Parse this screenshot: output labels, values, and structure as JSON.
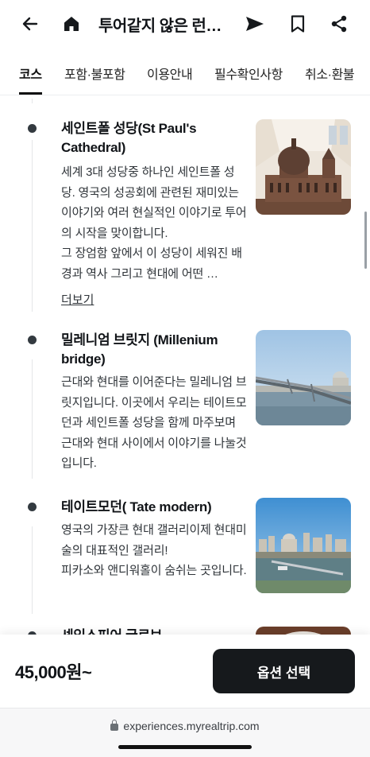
{
  "header": {
    "title": "투어같지 않은 런…",
    "icons": [
      "back-arrow-icon",
      "home-icon",
      "share-send-icon",
      "bookmark-icon",
      "share-icon"
    ]
  },
  "tabs": [
    {
      "label": "코스",
      "active": true
    },
    {
      "label": "포함·불포함",
      "active": false
    },
    {
      "label": "이용안내",
      "active": false
    },
    {
      "label": "필수확인사항",
      "active": false
    },
    {
      "label": "취소·환불",
      "active": false
    }
  ],
  "spots": [
    {
      "title": "세인트폴 성당(St Paul's Cathedral)",
      "description": "세계 3대 성당중 하나인 세인트폴 성당. 영국의 성공회에 관련된 재미있는 이야기와 여러 현실적인 이야기로 투어의 시작을 맞이합니다.\n그 장엄함 앞에서 이 성당이 세워진 배경과 역사 그리고 현대에 어떤 …",
      "more_label": "더보기",
      "image": "cathedral-photo"
    },
    {
      "title": "밀레니엄 브릿지 (Millenium bridge)",
      "description": "근대와 현대를 이어준다는 밀레니엄 브릿지입니다. 이곳에서 우리는 테이트모던과 세인트폴 성당을 함께 마주보며 근대와 현대 사이에서 이야기를 나눌것입니다.",
      "image": "bridge-photo"
    },
    {
      "title": "테이트모던( Tate modern)",
      "description": "영국의 가장큰 현대 갤러리이제 현대미술의 대표적인 갤러리!\n피카소와 앤디워홀이 숨쉬는 곳입니다.",
      "image": "river-view-photo"
    },
    {
      "title": "셰익스피어 글로브",
      "image": "globe-photo"
    }
  ],
  "bottom_bar": {
    "price": "45,000원~",
    "option_button": "옵션 선택"
  },
  "browser": {
    "url": "experiences.myrealtrip.com"
  },
  "colors": {
    "primary_button": "#16191c",
    "text": "#111418",
    "timeline": "#e4e6e8"
  }
}
